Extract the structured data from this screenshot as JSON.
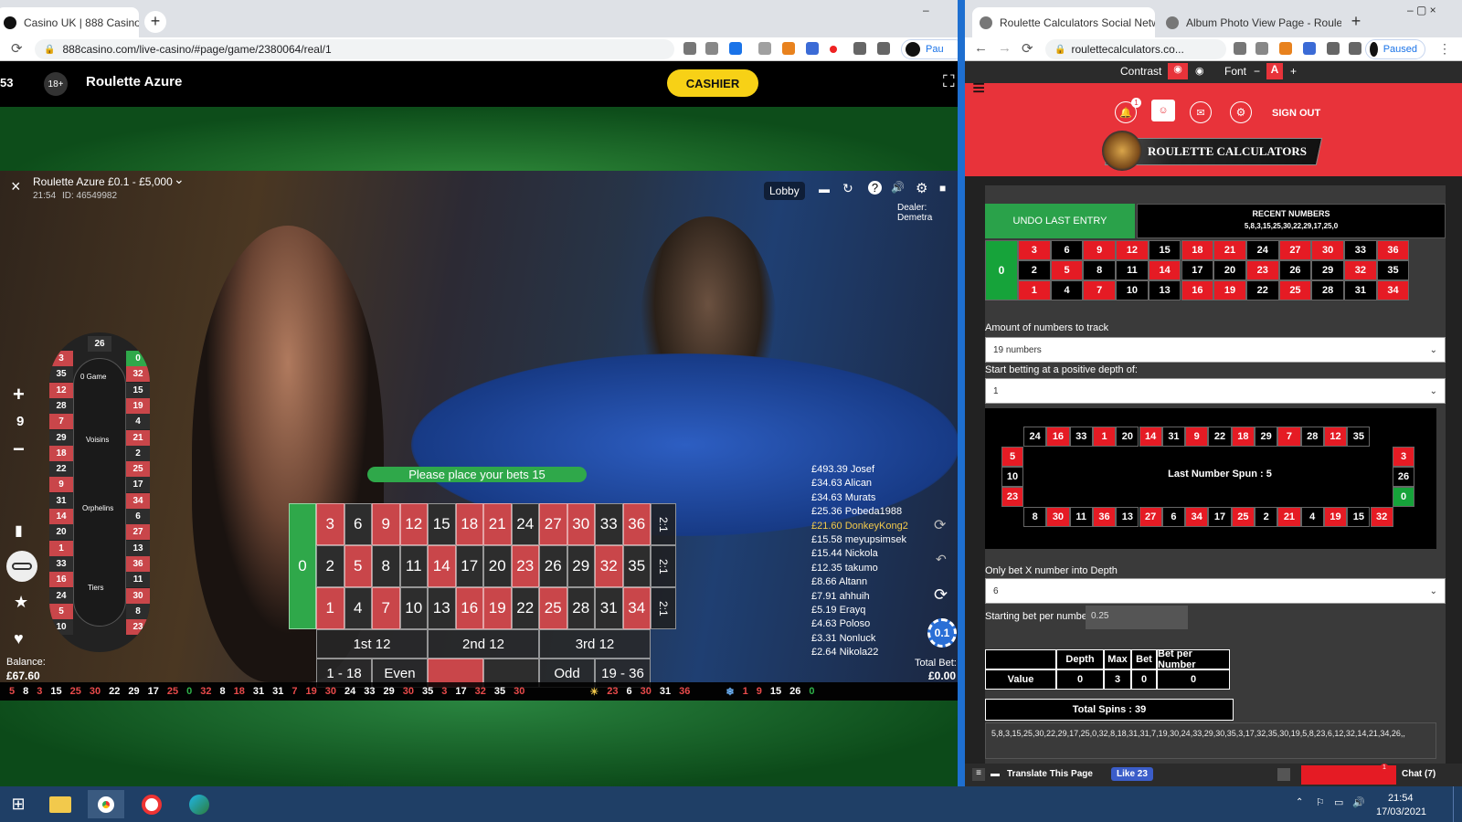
{
  "left_browser": {
    "tab_title": "Casino UK | 888 Casino",
    "tab_close": "×",
    "new_tab": "+",
    "url": "888casino.com/live-casino/#page/game/2380064/real/1",
    "nav": {
      "back": "←",
      "forward": "→",
      "reload": "⟳"
    },
    "profile": "Pau",
    "window_controls": "–"
  },
  "right_browser": {
    "tabs": [
      {
        "title": "Roulette Calculators Social Netw",
        "close": "×"
      },
      {
        "title": "Album Photo View Page - Roulet",
        "close": "×"
      }
    ],
    "new_tab": "+",
    "url": "roulettecalculators.co...",
    "nav": {
      "back": "←",
      "forward": "→",
      "reload": "⟳"
    },
    "profile": "Paused",
    "window_controls": "–   ▢   ×"
  },
  "casino": {
    "header": {
      "num_left": "53",
      "age": "18+",
      "game_title": "Roulette Azure",
      "cashier": "CASHIER",
      "fullscreen": "⛶"
    },
    "info": {
      "title": "Roulette Azure £0.1 - £5,000",
      "chev": "⌄",
      "time": "21:54",
      "id": "ID: 46549982",
      "close": "×"
    },
    "lobby": "Lobby",
    "icons": [
      "▬",
      "↻",
      "?",
      "🔊",
      "⚙",
      "■"
    ],
    "dealer": "Dealer: Demetra",
    "place_bets": "Please place your bets  15",
    "zero": "0",
    "columns_label": "2:1",
    "dozens": [
      "1st 12",
      "2nd 12",
      "3rd 12"
    ],
    "outside": [
      "1 - 18",
      "Even",
      "",
      "",
      "Odd",
      "19 - 36"
    ],
    "grid_rows": [
      [
        "3",
        "6",
        "9",
        "12",
        "15",
        "18",
        "21",
        "24",
        "27",
        "30",
        "33",
        "36"
      ],
      [
        "2",
        "5",
        "8",
        "11",
        "14",
        "17",
        "20",
        "23",
        "26",
        "29",
        "32",
        "35"
      ],
      [
        "1",
        "4",
        "7",
        "10",
        "13",
        "16",
        "19",
        "22",
        "25",
        "28",
        "31",
        "34"
      ]
    ],
    "grid_colors": [
      [
        "r",
        "b",
        "r",
        "r",
        "b",
        "r",
        "r",
        "b",
        "r",
        "r",
        "b",
        "r"
      ],
      [
        "b",
        "r",
        "b",
        "b",
        "r",
        "b",
        "b",
        "r",
        "b",
        "b",
        "r",
        "b"
      ],
      [
        "r",
        "b",
        "r",
        "b",
        "b",
        "r",
        "r",
        "b",
        "r",
        "b",
        "b",
        "r"
      ]
    ],
    "left_controls": {
      "plus": "+",
      "value": "9",
      "minus": "−",
      "chart": "▮",
      "star": "★",
      "heart": "♥"
    },
    "balance_label": "Balance:",
    "balance": "£67.60",
    "total_bet_label": "Total Bet:",
    "total_bet": "£0.00",
    "chip": "0.1",
    "wheel": {
      "left": [
        "3",
        "35",
        "12",
        "28",
        "7",
        "29",
        "18",
        "22",
        "9",
        "31",
        "14",
        "20",
        "1",
        "33",
        "16",
        "24",
        "5",
        "10"
      ],
      "left_colors": [
        "r",
        "b",
        "r",
        "b",
        "r",
        "b",
        "r",
        "b",
        "r",
        "b",
        "r",
        "b",
        "r",
        "b",
        "r",
        "b",
        "r",
        "b"
      ],
      "right": [
        "0",
        "32",
        "15",
        "19",
        "4",
        "21",
        "2",
        "25",
        "17",
        "34",
        "6",
        "27",
        "13",
        "36",
        "11",
        "30",
        "8",
        "23"
      ],
      "right_colors": [
        "g",
        "r",
        "b",
        "r",
        "b",
        "r",
        "b",
        "r",
        "b",
        "r",
        "b",
        "r",
        "b",
        "r",
        "b",
        "r",
        "b",
        "r"
      ],
      "top": "26",
      "labels": [
        "0 Game",
        "Voisins",
        "Orphelins",
        "Tiers"
      ]
    },
    "winners": [
      "£493.39 Josef",
      "£34.63 Alican",
      "£34.63 Murats",
      "£25.36 Pobeda1988",
      "£21.60 DonkeyKong2",
      "£15.58 meyupsimsek",
      "£15.44 Nickola",
      "£12.35 takumo",
      "£8.66 Altann",
      "£7.91 ahhuih",
      "£5.19 Erayq",
      "£4.63 Poloso",
      "£3.31 Nonluck",
      "£2.64 Nikola22"
    ],
    "history": [
      {
        "n": "5",
        "c": "r"
      },
      {
        "n": "8",
        "c": "w"
      },
      {
        "n": "3",
        "c": "r"
      },
      {
        "n": "15",
        "c": "w"
      },
      {
        "n": "25",
        "c": "r"
      },
      {
        "n": "30",
        "c": "r"
      },
      {
        "n": "22",
        "c": "w"
      },
      {
        "n": "29",
        "c": "w"
      },
      {
        "n": "17",
        "c": "w"
      },
      {
        "n": "25",
        "c": "r"
      },
      {
        "n": "0",
        "c": "g"
      },
      {
        "n": "32",
        "c": "r"
      },
      {
        "n": "8",
        "c": "w"
      },
      {
        "n": "18",
        "c": "r"
      },
      {
        "n": "31",
        "c": "w"
      },
      {
        "n": "31",
        "c": "w"
      },
      {
        "n": "7",
        "c": "r"
      },
      {
        "n": "19",
        "c": "r"
      },
      {
        "n": "30",
        "c": "r"
      },
      {
        "n": "24",
        "c": "w"
      },
      {
        "n": "33",
        "c": "w"
      },
      {
        "n": "29",
        "c": "w"
      },
      {
        "n": "30",
        "c": "r"
      },
      {
        "n": "35",
        "c": "w"
      },
      {
        "n": "3",
        "c": "r"
      },
      {
        "n": "17",
        "c": "w"
      },
      {
        "n": "32",
        "c": "r"
      },
      {
        "n": "35",
        "c": "w"
      },
      {
        "n": "30",
        "c": "r"
      }
    ],
    "hot": [
      {
        "n": "23",
        "c": "r"
      },
      {
        "n": "6",
        "c": "w"
      },
      {
        "n": "30",
        "c": "r"
      },
      {
        "n": "31",
        "c": "w"
      },
      {
        "n": "36",
        "c": "r"
      }
    ],
    "cold": [
      {
        "n": "1",
        "c": "r"
      },
      {
        "n": "9",
        "c": "r"
      },
      {
        "n": "15",
        "c": "w"
      },
      {
        "n": "26",
        "c": "w"
      },
      {
        "n": "0",
        "c": "g"
      }
    ]
  },
  "site": {
    "contrast_label": "Contrast",
    "font_label": "Font",
    "font_minus": "−",
    "font_a": "A",
    "font_plus": "+",
    "menu": "≡",
    "bell_badge": "1",
    "sign_out": "SIGN OUT",
    "logo_text": "ROULETTE CALCULATORS",
    "undo": "UNDO LAST ENTRY",
    "recent_title": "RECENT NUMBERS",
    "recent_list": "5,8,3,15,25,30,22,29,17,25,0",
    "entry_zero": "0",
    "entry_rows": [
      [
        "3",
        "6",
        "9",
        "12",
        "15",
        "18",
        "21",
        "24",
        "27",
        "30",
        "33",
        "36"
      ],
      [
        "2",
        "5",
        "8",
        "11",
        "14",
        "17",
        "20",
        "23",
        "26",
        "29",
        "32",
        "35"
      ],
      [
        "1",
        "4",
        "7",
        "10",
        "13",
        "16",
        "19",
        "22",
        "25",
        "28",
        "31",
        "34"
      ]
    ],
    "entry_colors": [
      [
        "r",
        "b",
        "r",
        "r",
        "b",
        "r",
        "r",
        "b",
        "r",
        "r",
        "b",
        "r"
      ],
      [
        "b",
        "r",
        "b",
        "b",
        "r",
        "b",
        "b",
        "r",
        "b",
        "b",
        "r",
        "b"
      ],
      [
        "r",
        "b",
        "r",
        "b",
        "b",
        "r",
        "r",
        "b",
        "r",
        "b",
        "b",
        "r"
      ]
    ],
    "track_label": "Amount of numbers to track",
    "track_value": "19 numbers",
    "depth_label": "Start betting at a positive depth of:",
    "depth_value": "1",
    "race_top": [
      "24",
      "16",
      "33",
      "1",
      "20",
      "14",
      "31",
      "9",
      "22",
      "18",
      "29",
      "7",
      "28",
      "12",
      "35"
    ],
    "race_top_colors": [
      "b",
      "r",
      "b",
      "r",
      "b",
      "r",
      "b",
      "r",
      "b",
      "r",
      "b",
      "r",
      "b",
      "r",
      "b"
    ],
    "race_bottom": [
      "8",
      "30",
      "11",
      "36",
      "13",
      "27",
      "6",
      "34",
      "17",
      "25",
      "2",
      "21",
      "4",
      "19",
      "15",
      "32"
    ],
    "race_bottom_colors": [
      "b",
      "r",
      "b",
      "r",
      "b",
      "r",
      "b",
      "r",
      "b",
      "r",
      "b",
      "r",
      "b",
      "r",
      "b",
      "r"
    ],
    "race_left": [
      "5",
      "10",
      "23"
    ],
    "race_left_colors": [
      "r",
      "b",
      "r"
    ],
    "race_right": [
      "3",
      "26",
      "0"
    ],
    "race_right_colors": [
      "r",
      "b",
      "g"
    ],
    "last_spun": "Last Number Spun : 5",
    "only_bet_label": "Only bet X number into Depth",
    "only_bet_value": "6",
    "starting_bet_label": "Starting bet per number",
    "starting_bet_value": "0.25",
    "table_headers": [
      "",
      "Depth",
      "Max",
      "Bet",
      "Bet per Number"
    ],
    "table_row": [
      "Value",
      "0",
      "3",
      "0",
      "0"
    ],
    "total_spins": "Total Spins : 39",
    "spins_list": "5,8,3,15,25,30,22,29,17,25,0,32,8,18,31,31,7,19,30,24,33,29,30,35,3,17,32,35,30,19,5,8,23,6,12,32,14,21,34,26,,",
    "footer": {
      "translate": "Translate This Page",
      "like": "Like 23",
      "chat": "Chat (7)",
      "badge": "1"
    }
  },
  "taskbar": {
    "time": "21:54",
    "date": "17/03/2021"
  },
  "colors": {
    "casino_red": "#c9464a",
    "site_red": "#e8333a",
    "cashier_yellow": "#f7d116",
    "green": "#2fa84a"
  }
}
